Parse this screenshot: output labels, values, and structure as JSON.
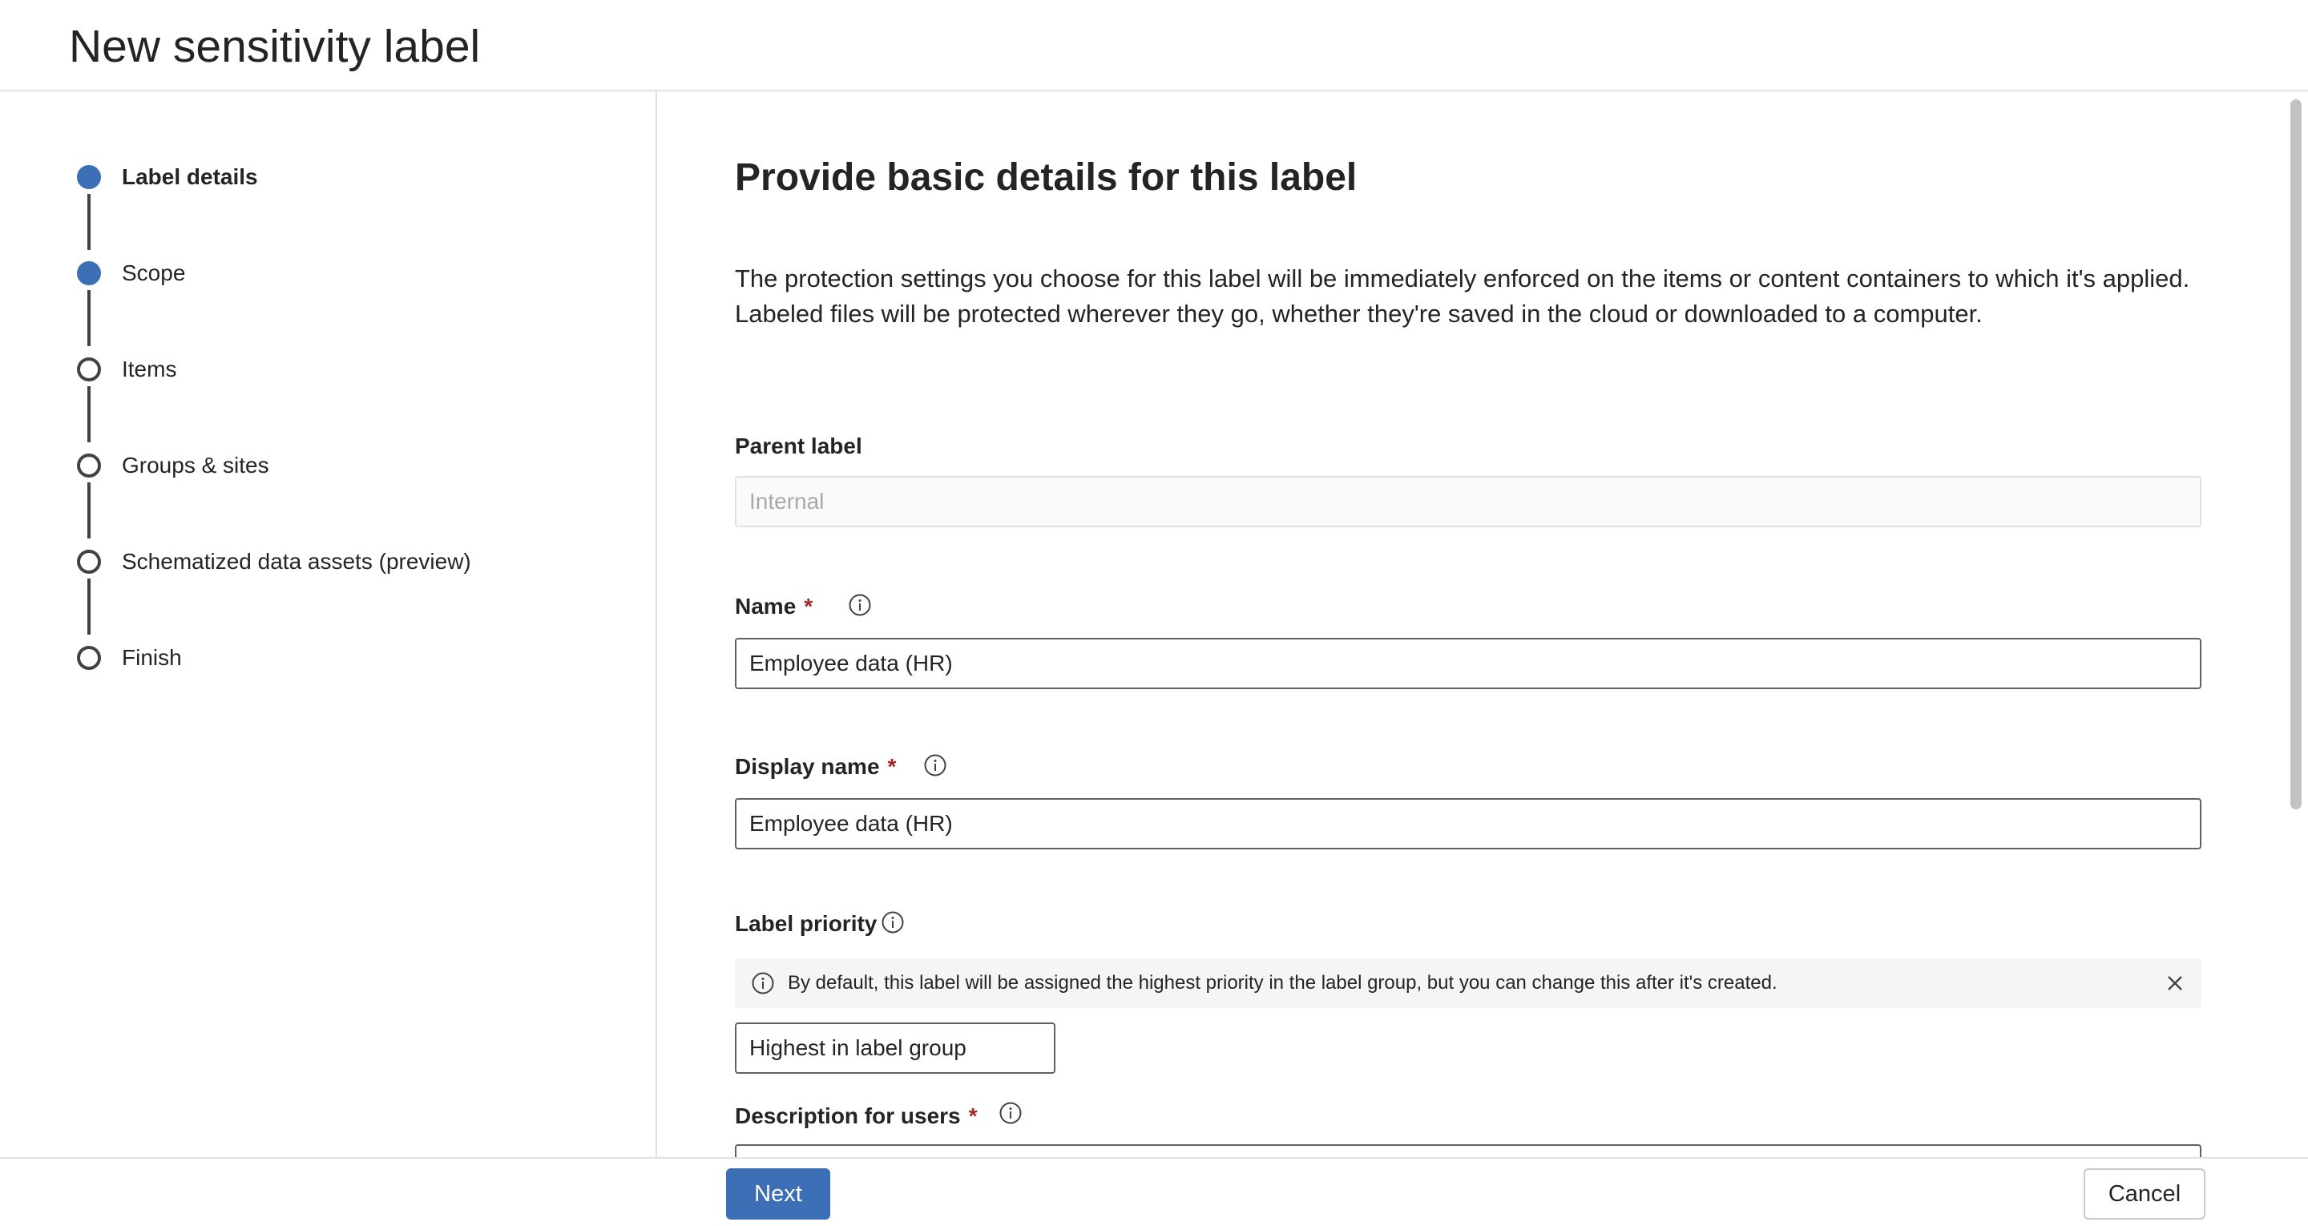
{
  "header": {
    "title": "New sensitivity label"
  },
  "wizard": {
    "steps": [
      {
        "label": "Label details",
        "state": "current"
      },
      {
        "label": "Scope",
        "state": "completed"
      },
      {
        "label": "Items",
        "state": "pending"
      },
      {
        "label": "Groups & sites",
        "state": "pending"
      },
      {
        "label": "Schematized data assets (preview)",
        "state": "pending"
      },
      {
        "label": "Finish",
        "state": "pending"
      }
    ]
  },
  "main": {
    "title": "Provide basic details for this label",
    "intro": "The protection settings you choose for this label will be immediately enforced on the items or content containers to which it's applied. Labeled files will be protected wherever they go, whether they're saved in the cloud or downloaded to a computer.",
    "parent_label": {
      "label": "Parent label",
      "placeholder": "Internal"
    },
    "name": {
      "label": "Name",
      "required_mark": "*",
      "value": "Employee data (HR)"
    },
    "display_name": {
      "label": "Display name",
      "required_mark": "*",
      "value": "Employee data (HR)"
    },
    "label_priority": {
      "label": "Label priority",
      "message": "By default, this label will be assigned the highest priority in the label group, but you can change this after it's created.",
      "value": "Highest in label group"
    },
    "description_for_users": {
      "label": "Description for users",
      "required_mark": "*"
    }
  },
  "footer": {
    "next_label": "Next",
    "cancel_label": "Cancel"
  },
  "colors": {
    "accent": "#3c6fb5",
    "required": "#a4262c",
    "border": "#616161"
  },
  "icons": {
    "info": "info-circle-icon",
    "close": "close-icon"
  }
}
